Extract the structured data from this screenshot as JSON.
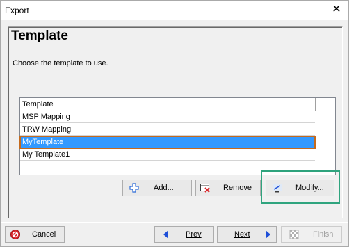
{
  "window": {
    "title": "Export",
    "close_glyph": "✕"
  },
  "page": {
    "title": "Template",
    "subtitle": "Choose the template to use."
  },
  "grid": {
    "column_header": "Template",
    "rows": [
      "MSP Mapping",
      "TRW Mapping",
      "MyTemplate",
      "My Template1"
    ],
    "selected_index": 2
  },
  "actions": {
    "add_label": "Add...",
    "remove_label": "Remove",
    "modify_label": "Modify..."
  },
  "footer": {
    "cancel_label": "Cancel",
    "prev_label": "Prev",
    "next_label": "Next",
    "finish_label": "Finish"
  },
  "colors": {
    "selection": "#3399ff",
    "selection_outline": "#c46a1e",
    "highlight_box": "#2fa47e",
    "nav_arrow": "#1e4fd8",
    "cancel_icon": "#d9262b"
  }
}
